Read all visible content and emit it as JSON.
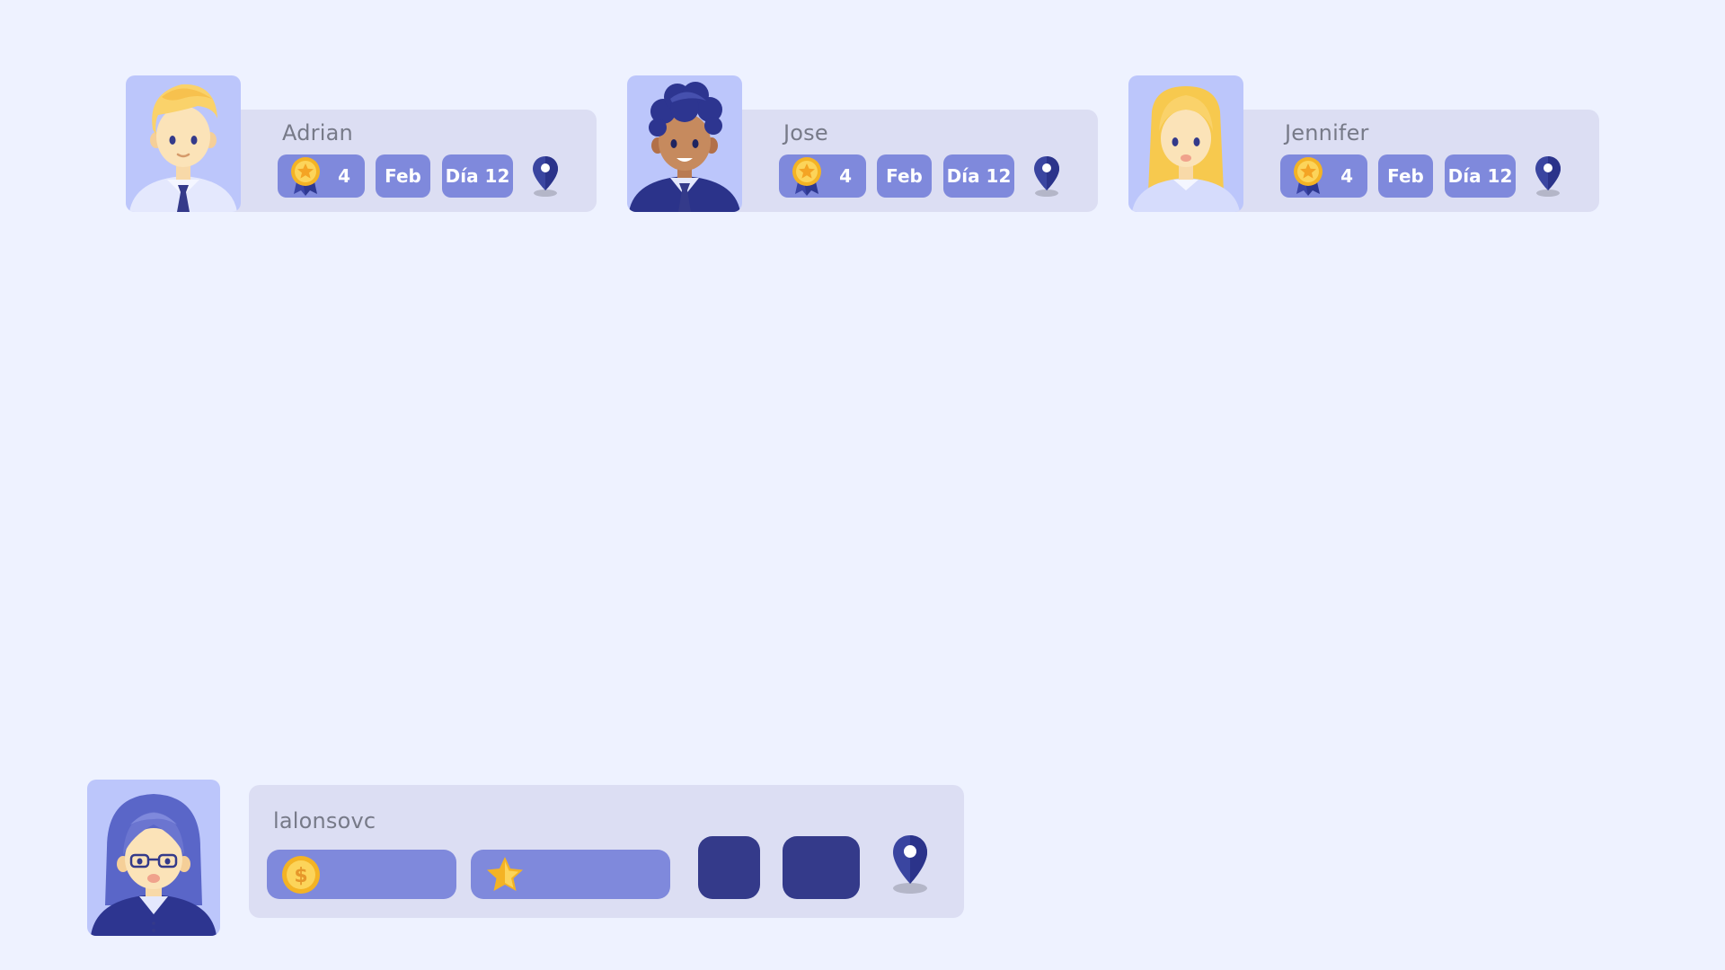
{
  "colors": {
    "background": "#eef2ff",
    "card": "#dcdef3",
    "avatar_bg": "#bcc6fb",
    "chip": "#7f89dc",
    "chip_text": "#ffffff",
    "dark_button": "#343a8a",
    "pin": "#3a45a0",
    "name_text": "#777a88"
  },
  "cards": [
    {
      "name": "Adrian",
      "avatar": "blond-man-avatar",
      "medal_icon": "gold-medal-icon",
      "medal_count": "4",
      "month": "Feb",
      "day": "Día 12",
      "location_icon": "location-pin-icon"
    },
    {
      "name": "Jose",
      "avatar": "curly-hair-man-avatar",
      "medal_icon": "gold-medal-icon",
      "medal_count": "4",
      "month": "Feb",
      "day": "Día 12",
      "location_icon": "location-pin-icon"
    },
    {
      "name": "Jennifer",
      "avatar": "blonde-woman-avatar",
      "medal_icon": "gold-medal-icon",
      "medal_count": "4",
      "month": "Feb",
      "day": "Día 12",
      "location_icon": "location-pin-icon"
    }
  ],
  "profile": {
    "name": "lalonsovc",
    "avatar": "woman-with-glasses-avatar",
    "coin_icon": "dollar-coin-icon",
    "star_icon": "star-icon",
    "location_icon": "location-pin-icon"
  }
}
